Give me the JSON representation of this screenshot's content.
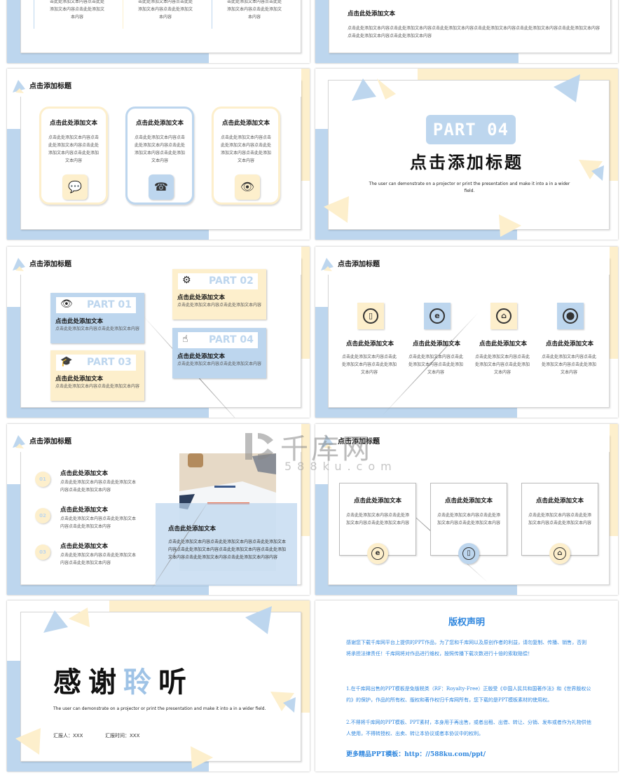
{
  "colors": {
    "blue": "#bdd6ee",
    "yellow": "#fdefcc",
    "part_blue": "#bdd6ee",
    "copyright_blue": "#2e86de"
  },
  "slide1": {
    "cols": [
      {
        "text": "击此处添加文本内容点击此处添加文本内容点击此处添加文本内容"
      },
      {
        "text": "击此处添加文本内容点击此处添加文本内容点击此处添加文本内容"
      },
      {
        "text": "击此处添加文本内容点击此处添加文本内容点击此处添加文本内容"
      }
    ]
  },
  "slide2": {
    "heading": "点击此处添加文本",
    "body": "点击此处添加文本内容点击此处添加文本内容点击此处添加文本内容点击此处添加文本内容点击此处添加文本内容点击此处添加文本内容点击此处添加文本内容点击此处添加文本内容"
  },
  "slide3": {
    "title": "点击添加标题",
    "cards": [
      {
        "heading": "点击此处添加文本",
        "body": "点击此处添加文本内容点击此处添加文本内容点击此处添加文本内容点击此处添加文本内容",
        "icon": "wechat-icon",
        "glyph": "💬"
      },
      {
        "heading": "点击此处添加文本",
        "body": "点击此处添加文本内容点击此处添加文本内容点击此处添加文本内容点击此处添加文本内容",
        "icon": "telephone-icon",
        "glyph": "☎"
      },
      {
        "heading": "点击此处添加文本",
        "body": "点击此处添加文本内容点击此处添加文本内容点击此处添加文本内容点击此处添加文本内容",
        "icon": "eye-icon",
        "glyph": "👁"
      }
    ]
  },
  "slide4": {
    "part": "PART  04",
    "title": "点击添加标题",
    "subtitle": "The user can demonstrate on a projector or print the presentation and make it into a in a wider field."
  },
  "slide5": {
    "title": "点击添加标题",
    "parts": [
      {
        "label": "PART 01",
        "heading": "点击此处添加文本",
        "body": "点击此处添加文本内容点击此处添加文本内容",
        "icon": "eye-icon",
        "glyph": "👁"
      },
      {
        "label": "PART 02",
        "heading": "点击此处添加文本",
        "body": "点击此处添加文本内容点击此处添加文本内容",
        "icon": "gears-icon",
        "glyph": "⚙"
      },
      {
        "label": "PART 03",
        "heading": "点击此处添加文本",
        "body": "点击此处添加文本内容点击此处添加文本内容",
        "icon": "graduation-cap-icon",
        "glyph": "🎓"
      },
      {
        "label": "PART 04",
        "heading": "点击此处添加文本",
        "body": "点击此处添加文本内容点击此处添加文本内容",
        "icon": "hand-pointer-icon",
        "glyph": "☝"
      }
    ]
  },
  "slide6": {
    "title": "点击添加标题",
    "items": [
      {
        "heading": "点击此处添加文本",
        "body": "点击此处添加文本内容点击此处添加文本内容点击此处添加文本内容",
        "icon": "mobile-phone-icon",
        "glyph": "▯"
      },
      {
        "heading": "点击此处添加文本",
        "body": "点击此处添加文本内容点击此处添加文本内容点击此处添加文本内容",
        "icon": "internet-explorer-icon",
        "glyph": "e"
      },
      {
        "heading": "点击此处添加文本",
        "body": "点击此处添加文本内容点击此处添加文本内容点击此处添加文本内容",
        "icon": "home-icon",
        "glyph": "⌂"
      },
      {
        "heading": "点击此处添加文本",
        "body": "点击此处添加文本内容点击此处添加文本内容点击此处添加文本内容",
        "icon": "location-pin-icon",
        "glyph": "⬤"
      }
    ]
  },
  "slide7": {
    "title": "点击添加标题",
    "list": [
      {
        "num": "01",
        "heading": "点击此处添加文本",
        "body": "点击此处添加文本内容点击此处添加文本内容点击此处添加文本内容"
      },
      {
        "num": "02",
        "heading": "点击此处添加文本",
        "body": "点击此处添加文本内容点击此处添加文本内容点击此处添加文本内容"
      },
      {
        "num": "03",
        "heading": "点击此处添加文本",
        "body": "点击此处添加文本内容点击此处添加文本内容点击此处添加文本内容"
      }
    ],
    "overlay_heading": "点击此处添加文本",
    "overlay_body": "点击此处添加文本内容点击此处添加文本内容点击此处添加文本内容点击此处添加文本内容点击此处添加文本内容点击此处添加文本内容点击此处添加文本内容点击此处添加文本内容内容"
  },
  "slide8": {
    "title": "点击添加标题",
    "cards": [
      {
        "heading": "点击此处添加文本",
        "body": "点击此处添加文本内容点击此处添加文本内容点击此处添加文本内容",
        "icon": "internet-explorer-icon",
        "glyph": "e"
      },
      {
        "heading": "点击此处添加文本",
        "body": "点击此处添加文本内容点击此处添加文本内容点击此处添加文本内容",
        "icon": "mobile-phone-icon",
        "glyph": "▯"
      },
      {
        "heading": "点击此处添加文本",
        "body": "点击此处添加文本内容点击此处添加文本内容点击此处添加文本内容",
        "icon": "home-icon",
        "glyph": "⌂"
      }
    ]
  },
  "slide9": {
    "title_chars": [
      "感",
      "谢",
      "聆",
      "听"
    ],
    "subtitle": "The user can demonstrate on a projector or print the presentation and make it into a in a wider field.",
    "reporter": "汇报人：XXX",
    "report_time": "汇报时间：XXX"
  },
  "slide10": {
    "title": "版权声明",
    "para1": "感谢您下载千库网平台上提供的PPT作品，为了您和千库网以及原创作者的利益，请勿复制、传播、销售，否则将承担法律责任！千库网将对作品进行维权，按照传播下载次数进行十倍的索取赔偿！",
    "para2": "1.在千库网出售的PPT模板是免版税类（RF：Royalty-Free）正版受《中国人民共和国著作法》和《世界版权公约》的保护，作品的所有权、版权和著作权归千库网所有，您下载的是PPT模板素材的使用权。",
    "para3": "2.不得将千库网的PPT模板、PPT素材，本身用于再出售，或者出租、出借、转让、分销、发布或者作为礼物供他人使用，不得转授权、出卖、转让本协议或者本协议中的权利。",
    "more": "更多精品PPT模板：http：//588ku.com/ppt/"
  },
  "watermark": {
    "brand": "千库网",
    "url": "588ku.com"
  }
}
